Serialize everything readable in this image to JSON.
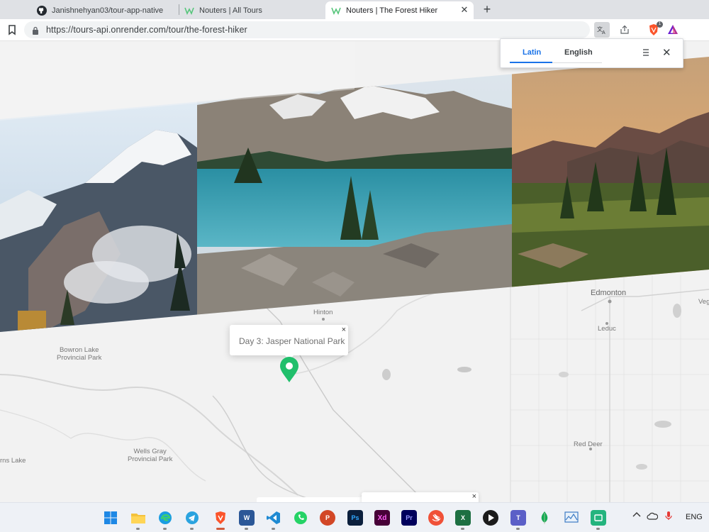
{
  "browser": {
    "tabs": [
      {
        "title": "Janishnehyan03/tour-app-native",
        "icon": "github-icon",
        "active": false
      },
      {
        "title": "Nouters | All Tours",
        "icon": "nouters-logo-icon",
        "active": false
      },
      {
        "title": "Nouters | The Forest Hiker",
        "icon": "nouters-logo-icon",
        "active": true
      }
    ],
    "url": "https://tours-api.onrender.com/tour/the-forest-hiker"
  },
  "translate_popup": {
    "tabs": [
      "Latin",
      "English"
    ],
    "selected": "Latin"
  },
  "map": {
    "labels": {
      "edmonton": "Edmonton",
      "hinton": "Hinton",
      "leduc": "Leduc",
      "bowron": "Bowron Lake\nProvincial Park",
      "wells": "Wells Gray\nProvincial Park",
      "reddeer": "Red Deer",
      "veg": "Veg",
      "rnslake": "rns Lake"
    },
    "popup_text": "Day 3: Jasper National Park",
    "close_symbol": "×",
    "pin_color": "#2ecc71"
  },
  "taskbar": {
    "apps": [
      "start",
      "file-explorer",
      "edge",
      "telegram",
      "brave",
      "word",
      "vscode",
      "whatsapp",
      "powerpoint",
      "photoshop",
      "adobe-xd",
      "premiere-pro",
      "swift-playgrounds",
      "excel",
      "media-player",
      "teams",
      "mongodb-compass",
      "resource-monitor",
      "snipping-tool"
    ],
    "language": "ENG"
  }
}
